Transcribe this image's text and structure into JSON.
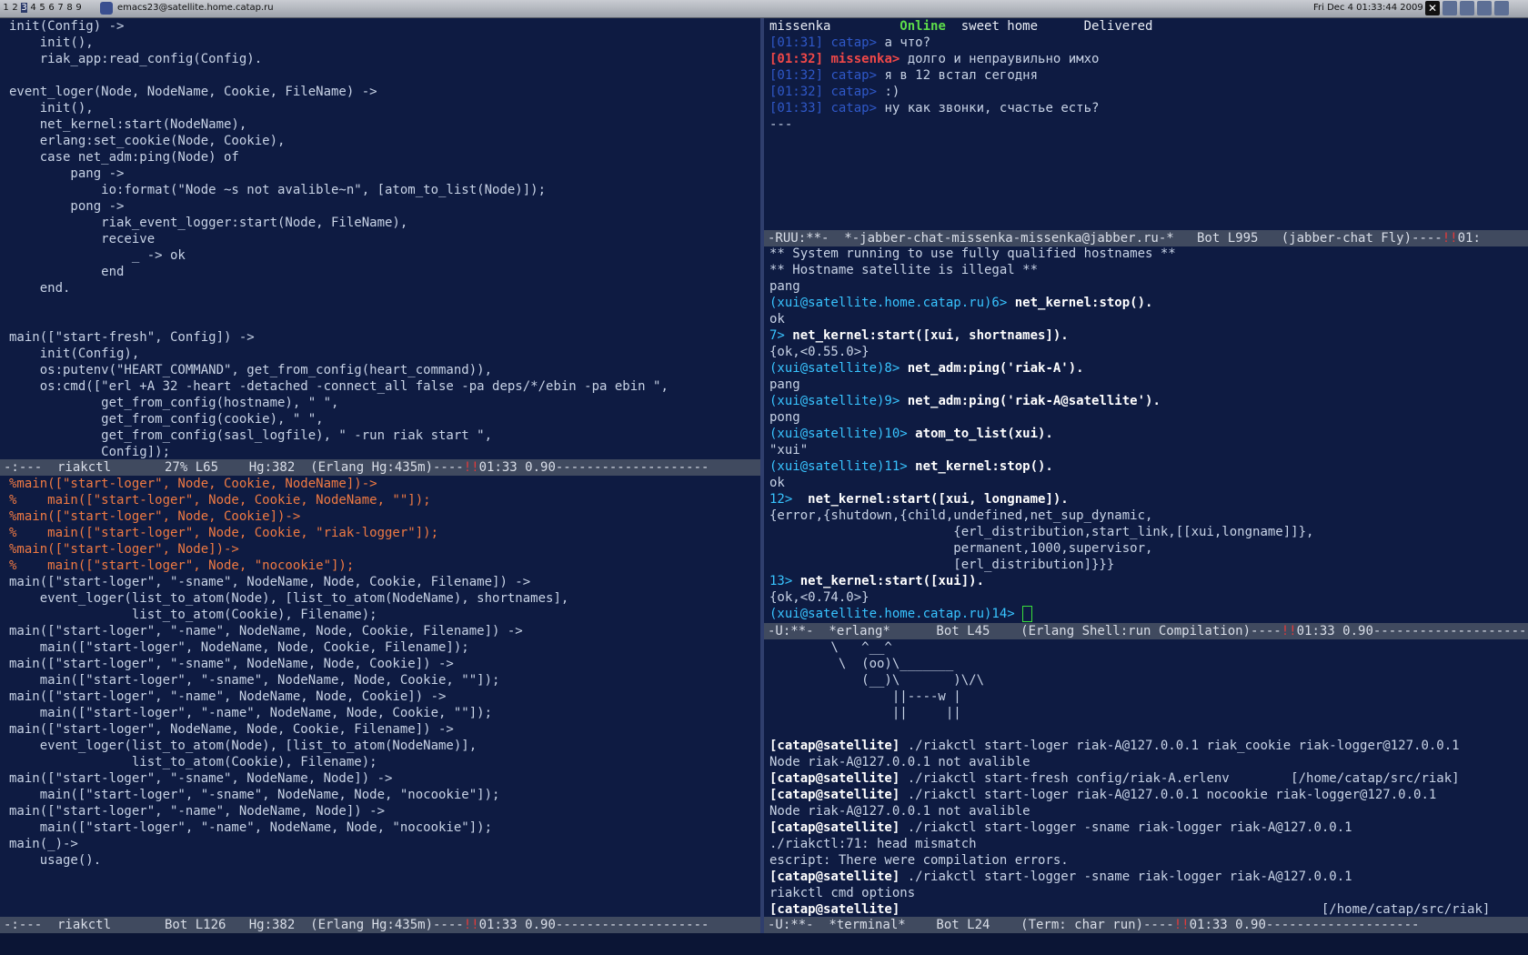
{
  "topbar": {
    "workspaces": [
      "1",
      "2",
      "3",
      "4",
      "5",
      "6",
      "7",
      "8",
      "9"
    ],
    "active_workspace": 2,
    "window_title": "emacs23@satellite.home.catap.ru",
    "clock": "Fri Dec  4 01:33:44 2009"
  },
  "left_top": {
    "lines": [
      "init(Config) ->",
      "    init(),",
      "    riak_app:read_config(Config).",
      "",
      "event_loger(Node, NodeName, Cookie, FileName) ->",
      "    init(),",
      "    net_kernel:start(NodeName),",
      "    erlang:set_cookie(Node, Cookie),",
      "    case net_adm:ping(Node) of",
      "        pang ->",
      "            io:format(\"Node ~s not avalible~n\", [atom_to_list(Node)]);",
      "        pong ->",
      "            riak_event_logger:start(Node, FileName),",
      "            receive",
      "                _ -> ok",
      "            end",
      "    end.",
      "",
      "",
      "main([\"start-fresh\", Config]) ->",
      "    init(Config),",
      "    os:putenv(\"HEART_COMMAND\", get_from_config(heart_command)),",
      "    os:cmd([\"erl +A 32 -heart -detached -connect_all false -pa deps/*/ebin -pa ebin \",",
      "            get_from_config(hostname), \" \",",
      "            get_from_config(cookie), \" \",",
      "            get_from_config(sasl_logfile), \" -run riak start \",",
      "            Config]);"
    ],
    "modeline": "-:---  riakctl       27% L65    Hg:382  (Erlang Hg:435m)----",
    "modeline_tail": "01:33 0.90--------------------"
  },
  "left_bottom": {
    "lines": [
      "%main([\"start-loger\", Node, Cookie, NodeName])->",
      "%    main([\"start-loger\", Node, Cookie, NodeName, \"\"]);",
      "%main([\"start-loger\", Node, Cookie])->",
      "%    main([\"start-loger\", Node, Cookie, \"riak-logger\"]);",
      "%main([\"start-loger\", Node])->",
      "%    main([\"start-loger\", Node, \"nocookie\"]);",
      "main([\"start-loger\", \"-sname\", NodeName, Node, Cookie, Filename]) ->",
      "    event_loger(list_to_atom(Node), [list_to_atom(NodeName), shortnames],",
      "                list_to_atom(Cookie), Filename);",
      "main([\"start-loger\", \"-name\", NodeName, Node, Cookie, Filename]) ->",
      "    main([\"start-loger\", NodeName, Node, Cookie, Filename]);",
      "main([\"start-loger\", \"-sname\", NodeName, Node, Cookie]) ->",
      "    main([\"start-loger\", \"-sname\", NodeName, Node, Cookie, \"\"]);",
      "main([\"start-loger\", \"-name\", NodeName, Node, Cookie]) ->",
      "    main([\"start-loger\", \"-name\", NodeName, Node, Cookie, \"\"]);",
      "main([\"start-loger\", NodeName, Node, Cookie, Filename]) ->",
      "    event_loger(list_to_atom(Node), [list_to_atom(NodeName)],",
      "                list_to_atom(Cookie), Filename);",
      "main([\"start-loger\", \"-sname\", NodeName, Node]) ->",
      "    main([\"start-loger\", \"-sname\", NodeName, Node, \"nocookie\"]);",
      "main([\"start-loger\", \"-name\", NodeName, Node]) ->",
      "    main([\"start-loger\", \"-name\", NodeName, Node, \"nocookie\"]);",
      "main(_)->",
      "    usage()."
    ],
    "modeline": "-:---  riakctl       Bot L126   Hg:382  (Erlang Hg:435m)----",
    "modeline_tail": "01:33 0.90--------------------"
  },
  "chat": {
    "header": {
      "contact": "missenka",
      "status": "Online",
      "status_msg": "sweet home",
      "delivery": "Delivered"
    },
    "messages": [
      {
        "time": "[01:31]",
        "nick": "catap>",
        "text": "а что?",
        "self": true
      },
      {
        "time": "[01:32]",
        "nick": "missenka>",
        "text": "долго и непраувильно имхо",
        "self": false
      },
      {
        "time": "[01:32]",
        "nick": "catap>",
        "text": "я в 12 встал сегодня",
        "self": true
      },
      {
        "time": "[01:32]",
        "nick": "catap>",
        "text": ":)",
        "self": true
      },
      {
        "time": "[01:33]",
        "nick": "catap>",
        "text": "ну как звонки, счастье есть?",
        "self": true
      }
    ],
    "separator": "---",
    "modeline": "-RUU:**-  *-jabber-chat-missenka-missenka@jabber.ru-*   Bot L995   (jabber-chat Fly)----",
    "modeline_tail": "01:"
  },
  "erlang_shell": {
    "lines": [
      {
        "t": "out",
        "text": "** System running to use fully qualified hostnames **"
      },
      {
        "t": "out",
        "text": "** Hostname satellite is illegal **"
      },
      {
        "t": "out",
        "text": "pang"
      },
      {
        "t": "cmd",
        "prompt": "(xui@satellite.home.catap.ru)6>",
        "text": " net_kernel:stop()."
      },
      {
        "t": "out",
        "text": "ok"
      },
      {
        "t": "cmd",
        "prompt": "7>",
        "text": " net_kernel:start([xui, shortnames])."
      },
      {
        "t": "out",
        "text": "{ok,<0.55.0>}"
      },
      {
        "t": "cmd",
        "prompt": "(xui@satellite)8>",
        "text": " net_adm:ping('riak-A')."
      },
      {
        "t": "out",
        "text": "pang"
      },
      {
        "t": "cmd",
        "prompt": "(xui@satellite)9>",
        "text": " net_adm:ping('riak-A@satellite')."
      },
      {
        "t": "out",
        "text": "pong"
      },
      {
        "t": "cmd",
        "prompt": "(xui@satellite)10>",
        "text": " atom_to_list(xui)."
      },
      {
        "t": "out",
        "text": "\"xui\""
      },
      {
        "t": "cmd",
        "prompt": "(xui@satellite)11>",
        "text": " net_kernel:stop()."
      },
      {
        "t": "out",
        "text": "ok"
      },
      {
        "t": "cmd",
        "prompt": "12>",
        "text": "  net_kernel:start([xui, longname])."
      },
      {
        "t": "out",
        "text": "{error,{shutdown,{child,undefined,net_sup_dynamic,"
      },
      {
        "t": "out",
        "text": "                        {erl_distribution,start_link,[[xui,longname]]},"
      },
      {
        "t": "out",
        "text": "                        permanent,1000,supervisor,"
      },
      {
        "t": "out",
        "text": "                        [erl_distribution]}}}"
      },
      {
        "t": "cmd",
        "prompt": "13>",
        "text": " net_kernel:start([xui])."
      },
      {
        "t": "out",
        "text": "{ok,<0.74.0>}"
      },
      {
        "t": "cmd",
        "prompt": "(xui@satellite.home.catap.ru)14>",
        "text": " "
      }
    ],
    "modeline": "-U:**-  *erlang*      Bot L45    (Erlang Shell:run Compilation)----",
    "modeline_tail": "01:33 0.90--------------------"
  },
  "terminal": {
    "lines": [
      {
        "t": "art",
        "text": "        \\   ^__^"
      },
      {
        "t": "art",
        "text": "         \\  (oo)\\_______"
      },
      {
        "t": "art",
        "text": "            (__)\\       )\\/\\"
      },
      {
        "t": "art",
        "text": "                ||----w |"
      },
      {
        "t": "art",
        "text": "                ||     ||"
      },
      {
        "t": "art",
        "text": ""
      },
      {
        "t": "cmd",
        "user": "[catap@satellite]",
        "text": " ./riakctl start-loger riak-A@127.0.0.1 riak_cookie riak-logger@127.0.0.1"
      },
      {
        "t": "out",
        "text": "Node riak-A@127.0.0.1 not avalible"
      },
      {
        "t": "cmd",
        "user": "[catap@satellite]",
        "text": " ./riakctl start-fresh config/riak-A.erlenv        [/home/catap/src/riak]"
      },
      {
        "t": "cmd",
        "user": "[catap@satellite]",
        "text": " ./riakctl start-loger riak-A@127.0.0.1 nocookie riak-logger@127.0.0.1"
      },
      {
        "t": "out",
        "text": "Node riak-A@127.0.0.1 not avalible"
      },
      {
        "t": "cmd",
        "user": "[catap@satellite]",
        "text": " ./riakctl start-logger -sname riak-logger riak-A@127.0.0.1"
      },
      {
        "t": "out",
        "text": "./riakctl:71: head mismatch"
      },
      {
        "t": "out",
        "text": "escript: There were compilation errors."
      },
      {
        "t": "cmd",
        "user": "[catap@satellite]",
        "text": " ./riakctl start-logger -sname riak-logger riak-A@127.0.0.1"
      },
      {
        "t": "out",
        "text": "riakctl cmd options"
      },
      {
        "t": "cmd",
        "user": "[catap@satellite]",
        "text": "                                                       [/home/catap/src/riak]"
      }
    ],
    "modeline": "-U:**-  *terminal*    Bot L24    (Term: char run)----",
    "modeline_tail": "01:33 0.90--------------------"
  }
}
